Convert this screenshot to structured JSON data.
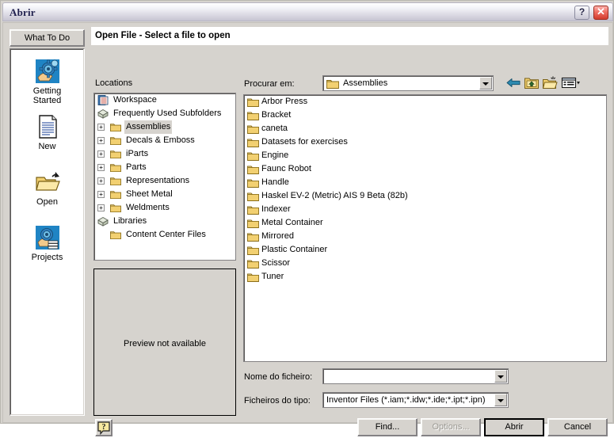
{
  "window": {
    "title": "Abrir",
    "help_button": "?",
    "close_button": "✕"
  },
  "sidebar": {
    "what_to_do_label": "What To Do",
    "items": [
      {
        "label": "Getting\nStarted",
        "line1": "Getting",
        "line2": "Started",
        "icon": "gear-hand-icon"
      },
      {
        "label": "New",
        "line1": "New",
        "line2": "",
        "icon": "new-document-icon"
      },
      {
        "label": "Open",
        "line1": "Open",
        "line2": "",
        "icon": "open-folder-icon"
      },
      {
        "label": "Projects",
        "line1": "Projects",
        "line2": "",
        "icon": "projects-icon"
      }
    ]
  },
  "header": {
    "title": "Open File - Select a file to open"
  },
  "locations": {
    "label": "Locations",
    "tree": [
      {
        "name": "Workspace",
        "indent": 0,
        "expander": "",
        "icon": "workspace-icon",
        "selected": false
      },
      {
        "name": "Frequently Used Subfolders",
        "indent": 0,
        "expander": "",
        "icon": "bundle-icon",
        "selected": false
      },
      {
        "name": "Assemblies",
        "indent": 1,
        "expander": "+",
        "icon": "folder-icon",
        "selected": true
      },
      {
        "name": "Decals & Emboss",
        "indent": 1,
        "expander": "+",
        "icon": "folder-icon",
        "selected": false
      },
      {
        "name": "iParts",
        "indent": 1,
        "expander": "+",
        "icon": "folder-icon",
        "selected": false
      },
      {
        "name": "Parts",
        "indent": 1,
        "expander": "+",
        "icon": "folder-icon",
        "selected": false
      },
      {
        "name": "Representations",
        "indent": 1,
        "expander": "+",
        "icon": "folder-icon",
        "selected": false
      },
      {
        "name": "Sheet Metal",
        "indent": 1,
        "expander": "+",
        "icon": "folder-icon",
        "selected": false
      },
      {
        "name": "Weldments",
        "indent": 1,
        "expander": "+",
        "icon": "folder-icon",
        "selected": false
      },
      {
        "name": "Libraries",
        "indent": 0,
        "expander": "",
        "icon": "bundle-icon",
        "selected": false
      },
      {
        "name": "Content Center Files",
        "indent": 1,
        "expander": "",
        "icon": "folder-icon",
        "selected": false
      }
    ]
  },
  "preview": {
    "message": "Preview not available"
  },
  "toolbar": {
    "look_in_label": "Procurar em:",
    "look_in_value": "Assemblies",
    "icons": [
      {
        "name": "back-arrow-icon",
        "title": "Back"
      },
      {
        "name": "up-folder-icon",
        "title": "Up One Level"
      },
      {
        "name": "new-folder-icon",
        "title": "Create New Folder"
      },
      {
        "name": "views-menu-icon",
        "title": "Views"
      }
    ]
  },
  "filelist": {
    "items": [
      {
        "name": "Arbor Press",
        "icon": "folder-icon"
      },
      {
        "name": "Bracket",
        "icon": "folder-icon"
      },
      {
        "name": "caneta",
        "icon": "folder-icon"
      },
      {
        "name": "Datasets for exercises",
        "icon": "folder-icon"
      },
      {
        "name": "Engine",
        "icon": "folder-icon"
      },
      {
        "name": "Faunc Robot",
        "icon": "folder-icon"
      },
      {
        "name": "Handle",
        "icon": "folder-icon"
      },
      {
        "name": "Haskel EV-2 (Metric) AIS 9 Beta (82b)",
        "icon": "folder-icon"
      },
      {
        "name": "Indexer",
        "icon": "folder-icon"
      },
      {
        "name": "Metal Container",
        "icon": "folder-icon"
      },
      {
        "name": "Mirrored",
        "icon": "folder-icon"
      },
      {
        "name": "Plastic Container",
        "icon": "folder-icon"
      },
      {
        "name": "Scissor",
        "icon": "folder-icon"
      },
      {
        "name": "Tuner",
        "icon": "folder-icon"
      }
    ]
  },
  "form": {
    "file_name_label": "Nome do ficheiro:",
    "file_name_value": "",
    "file_type_label": "Ficheiros do tipo:",
    "file_type_value": "Inventor Files (*.iam;*.idw;*.ide;*.ipt;*.ipn)"
  },
  "buttons": {
    "help": "?",
    "find": "Find...",
    "options": "Options...",
    "open": "Abrir",
    "cancel": "Cancel"
  },
  "colors": {
    "dialog_face": "#d6d3ce",
    "folder_yellow": "#f2d071",
    "accent_blue": "#2d8ab0",
    "close_red": "#d23b2c"
  }
}
